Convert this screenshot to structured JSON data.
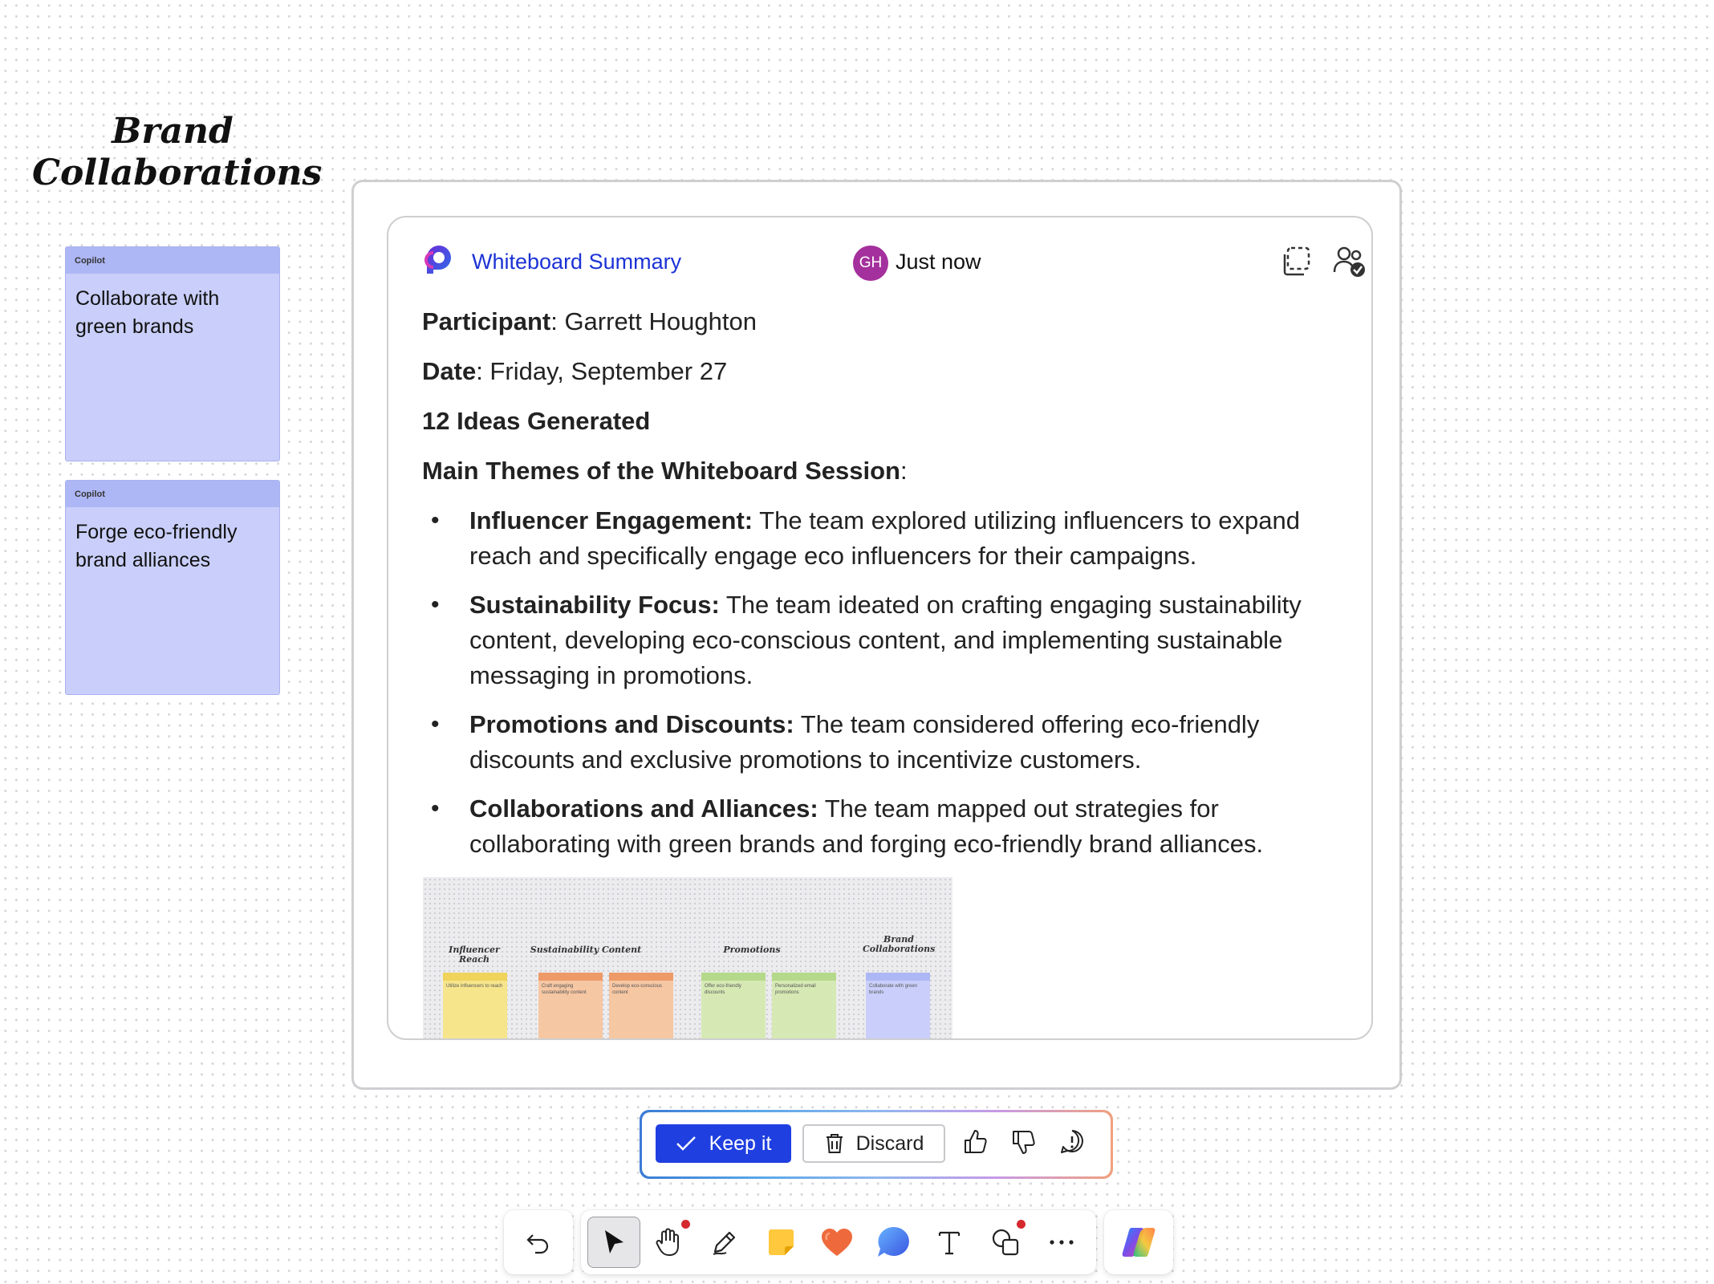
{
  "board": {
    "title": "Brand Collaborations",
    "stickies": [
      {
        "tag": "Copilot",
        "text": "Collaborate with green brands"
      },
      {
        "tag": "Copilot",
        "text": "Forge eco-friendly brand alliances"
      }
    ]
  },
  "summary": {
    "title": "Whiteboard Summary",
    "author_initials": "GH",
    "timestamp": "Just now",
    "participant_label": "Participant",
    "participant_value": ": Garrett Houghton",
    "date_label": "Date",
    "date_value": ": Friday, September 27",
    "ideas_count": "12 Ideas Generated",
    "themes_heading": "Main Themes of the Whiteboard Session",
    "themes_colon": ":",
    "themes": [
      {
        "title": "Influencer Engagement:",
        "text": " The team explored utilizing influencers to expand reach and specifically engage eco influencers for their campaigns."
      },
      {
        "title": "Sustainability Focus:",
        "text": " The team ideated on crafting engaging sustainability content, developing eco-conscious content, and implementing sustainable messaging in promotions."
      },
      {
        "title": "Promotions and Discounts:",
        "text": " The team considered offering eco-friendly discounts and exclusive promotions to incentivize customers."
      },
      {
        "title": "Collaborations and Alliances:",
        "text": " The team mapped out strategies for collaborating with green brands and forging eco-friendly brand alliances."
      }
    ],
    "thumbnail": {
      "labels": [
        "Influencer Reach",
        "Sustainability Content",
        "Promotions",
        "Brand Collaborations"
      ],
      "notes": [
        {
          "text": "Utilize influencers to reach",
          "color": "#f7e58c",
          "head": "#efd35b"
        },
        {
          "text": "Craft engaging sustainability content",
          "color": "#f6c7a3",
          "head": "#ee9a68"
        },
        {
          "text": "Develop eco-conscious content",
          "color": "#f6c7a3",
          "head": "#ee9a68"
        },
        {
          "text": "Offer eco-friendly discounts",
          "color": "#d6e9b4",
          "head": "#b5d98a"
        },
        {
          "text": "Personalized email promotions",
          "color": "#d6e9b4",
          "head": "#b5d98a"
        },
        {
          "text": "Collaborate with green brands",
          "color": "#c9cffa",
          "head": "#aeb7f5"
        }
      ]
    }
  },
  "actions": {
    "keep_label": "Keep it",
    "discard_label": "Discard"
  },
  "toolbar": {
    "tools": [
      "undo-icon",
      "select-icon",
      "pan-icon",
      "pen-icon",
      "sticky-note-icon",
      "reaction-icon",
      "comment-icon",
      "text-icon",
      "shapes-icon",
      "more-icon",
      "copilot-icon"
    ]
  },
  "colors": {
    "accent": "#1f3fe0",
    "title_blue": "#1c33d6",
    "sticky_lavender": "#c9cffa",
    "avatar": "#a3309c"
  }
}
